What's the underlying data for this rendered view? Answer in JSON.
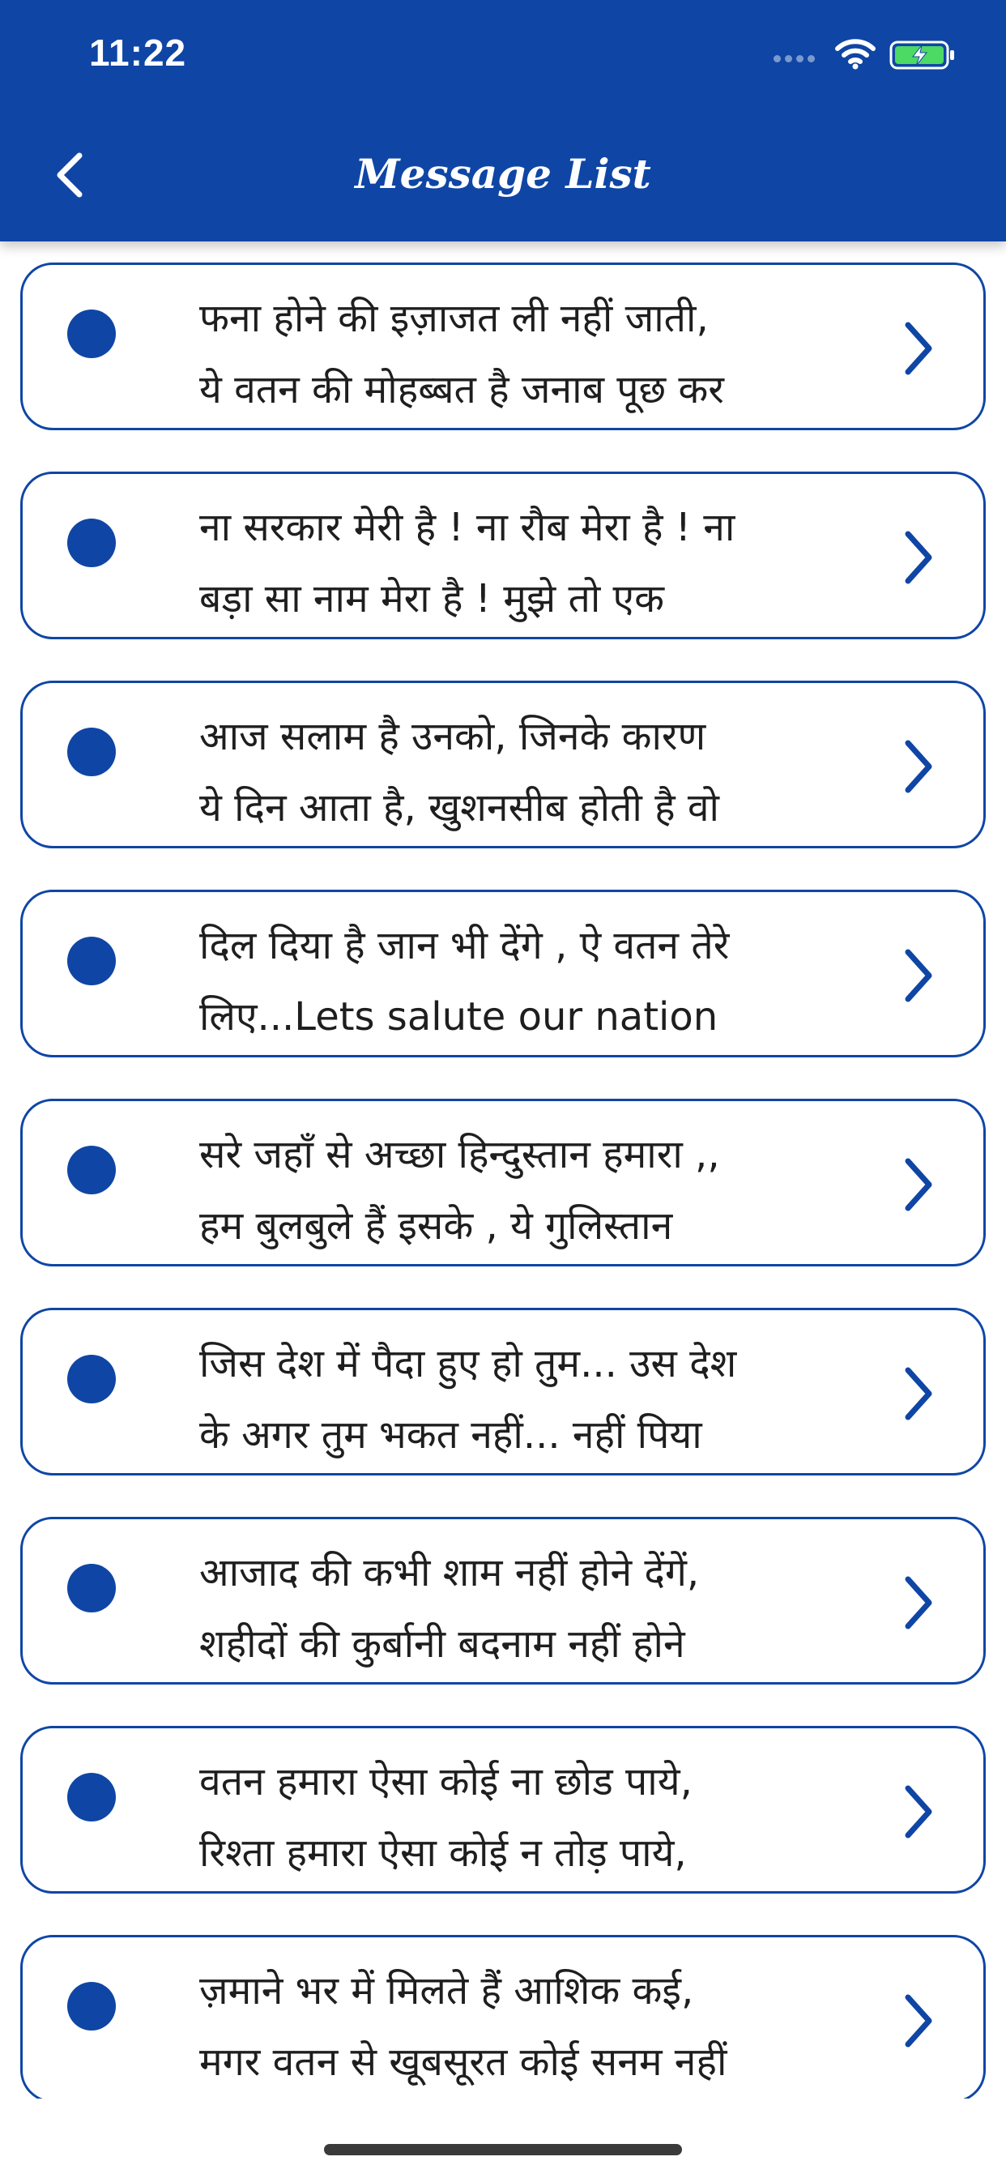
{
  "status_bar": {
    "time": "11:22"
  },
  "header": {
    "title": "Message List",
    "back_icon": "chevron-left-icon"
  },
  "colors": {
    "primary": "#0f46a5",
    "text": "#1e1e1e",
    "background": "#ffffff"
  },
  "messages": [
    {
      "text": "फना होने की इज़ाजत ली नहीं जाती,\nये वतन की मोहब्बत है जनाब पूछ कर"
    },
    {
      "text": "ना सरकार मेरी है ! ना रौब मेरा है ! ना\nबड़ा सा नाम मेरा है ! मुझे तो एक"
    },
    {
      "text": "आज सलाम है उनको, जिनके कारण\nये दिन आता है, खुशनसीब होती है वो"
    },
    {
      "text": "दिल दिया है जान भी देंगे , ऐ वतन तेरे\nलिए...Lets salute our nation"
    },
    {
      "text": "सरे जहाँ से अच्छा हिन्दुस्तान हमारा ,,\nहम बुलबुले हैं इसके , ये गुलिस्तान"
    },
    {
      "text": "जिस देश में पैदा हुए हो तुम... उस देश\nके अगर तुम भकत नहीं... नहीं पिया"
    },
    {
      "text": "आजाद की कभी शाम नहीं होने देंगें,\nशहीदों की कुर्बानी बदनाम नहीं होने"
    },
    {
      "text": "वतन हमारा ऐसा कोई ना छोड पाये,\nरिश्ता हमारा ऐसा कोई न तोड़ पाये,"
    },
    {
      "text": "ज़माने भर में मिलते हैं आशिक कई,\nमगर वतन से खूबसूरत कोई सनम नहीं"
    }
  ]
}
